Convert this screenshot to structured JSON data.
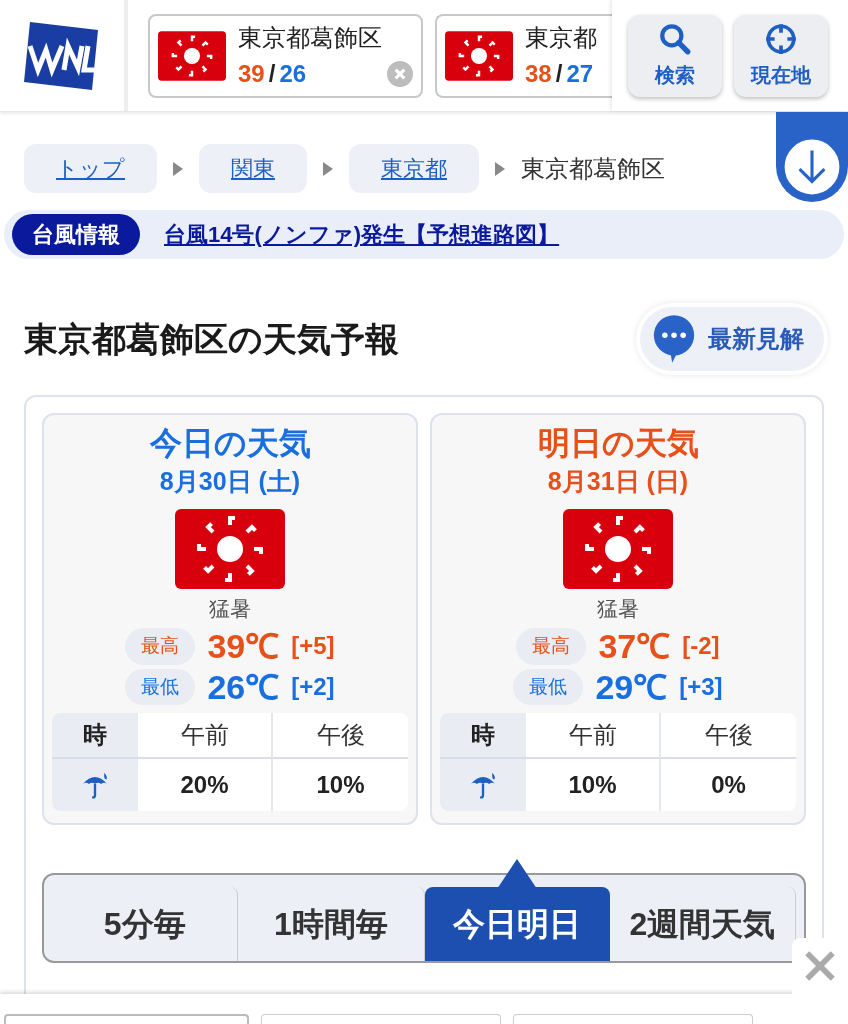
{
  "header": {
    "favorites": [
      {
        "name": "東京都葛飾区",
        "high": "39",
        "sep": "/",
        "low": "26",
        "removable": true
      },
      {
        "name": "東京都",
        "high": "38",
        "sep": "/",
        "low": "27",
        "removable": false
      }
    ],
    "buttons": [
      {
        "kind": "search",
        "label": "検索"
      },
      {
        "kind": "locate",
        "label": "現在地"
      }
    ]
  },
  "breadcrumb": [
    {
      "label": "トップ",
      "kind": "link"
    },
    {
      "label": "関東",
      "kind": "link"
    },
    {
      "label": "東京都",
      "kind": "link"
    },
    {
      "label": "東京都葛飾区",
      "kind": "current"
    }
  ],
  "alert": {
    "badge": "台風情報",
    "link": "台風14号(ノンファ)発生【予想進路図】"
  },
  "title": "東京都葛飾区の天気予報",
  "commentary_button": "最新見解",
  "days": [
    {
      "kind": "today",
      "title": "今日の天気",
      "date": "8月30日 (土)",
      "weather": "猛暑",
      "high": {
        "label": "最高",
        "temp": "39℃",
        "diff": "[+5]"
      },
      "low": {
        "label": "最低",
        "temp": "26℃",
        "diff": "[+2]"
      },
      "precip": {
        "hour_label": "時",
        "periods": [
          "午前",
          "午後"
        ],
        "values": [
          "20%",
          "10%"
        ]
      }
    },
    {
      "kind": "tomorrow",
      "title": "明日の天気",
      "date": "8月31日 (日)",
      "weather": "猛暑",
      "high": {
        "label": "最高",
        "temp": "37℃",
        "diff": "[-2]"
      },
      "low": {
        "label": "最低",
        "temp": "29℃",
        "diff": "[+3]"
      },
      "precip": {
        "hour_label": "時",
        "periods": [
          "午前",
          "午後"
        ],
        "values": [
          "10%",
          "0%"
        ]
      }
    }
  ],
  "tabs": [
    {
      "label": "5分毎",
      "selected": false
    },
    {
      "label": "1時間毎",
      "selected": false
    },
    {
      "label": "今日明日",
      "selected": true
    },
    {
      "label": "2週間天気",
      "selected": false
    }
  ]
}
